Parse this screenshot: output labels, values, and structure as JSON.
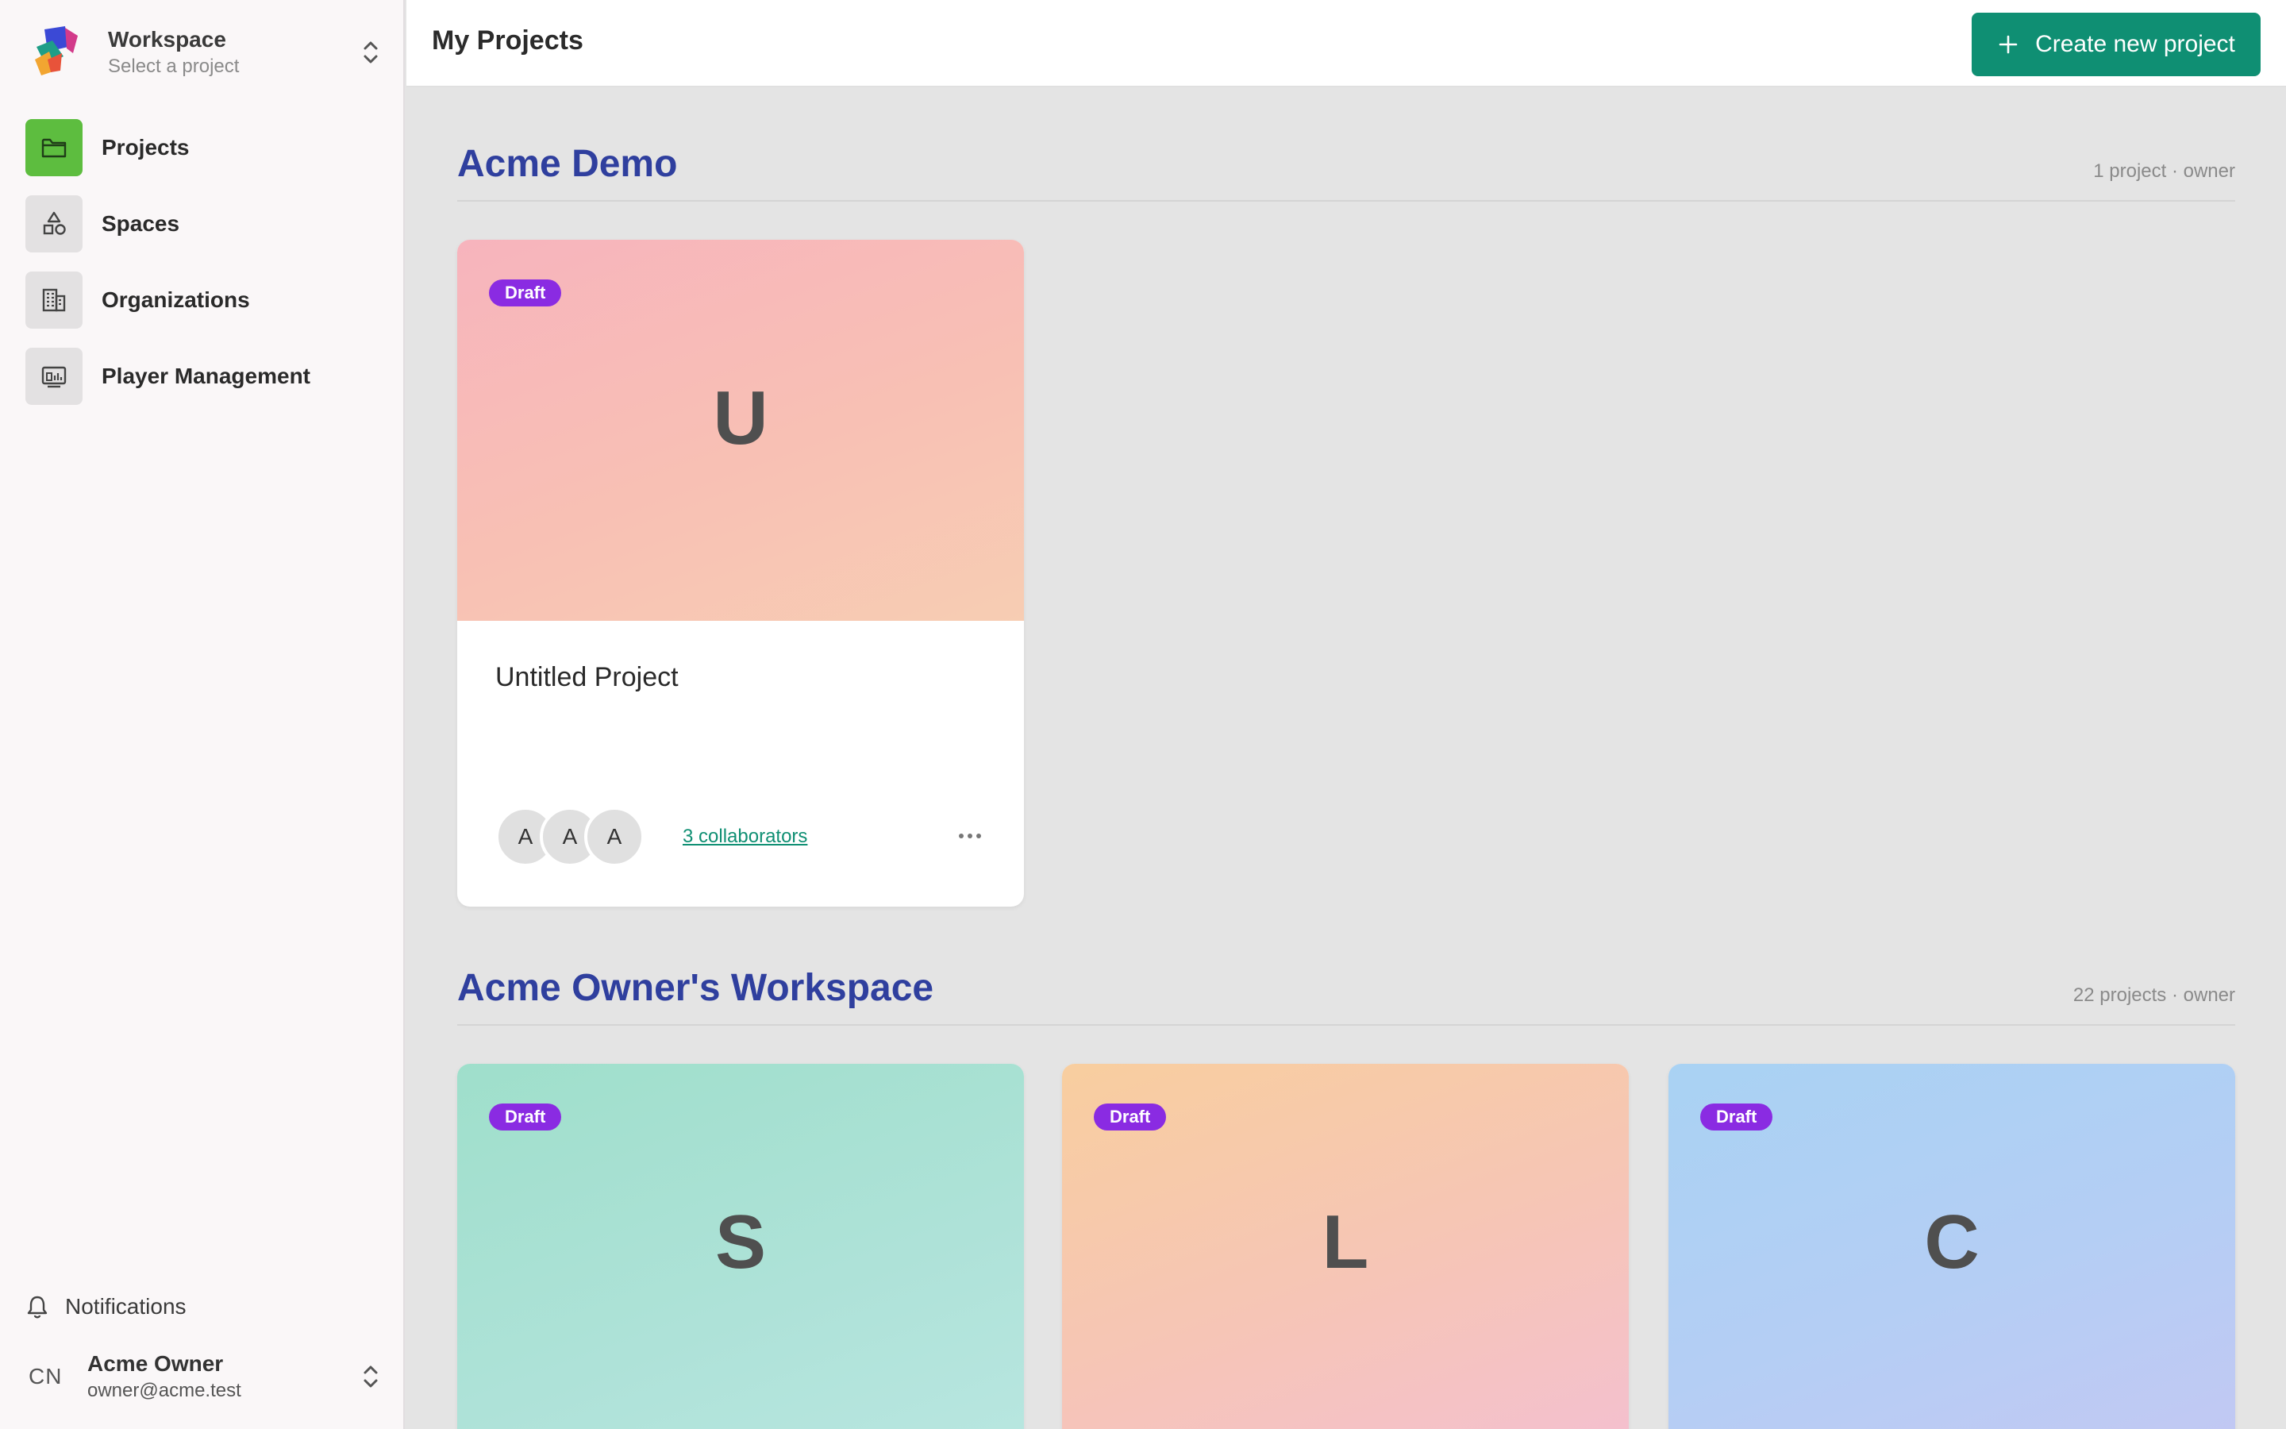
{
  "workspace": {
    "title": "Workspace",
    "subtitle": "Select a project"
  },
  "nav": [
    {
      "label": "Projects",
      "icon": "folder-icon",
      "active": true
    },
    {
      "label": "Spaces",
      "icon": "shapes-icon",
      "active": false
    },
    {
      "label": "Organizations",
      "icon": "building-icon",
      "active": false
    },
    {
      "label": "Player Management",
      "icon": "player-monitor-icon",
      "active": false
    }
  ],
  "notifications": {
    "label": "Notifications",
    "icon": "bell-icon"
  },
  "user": {
    "initials": "CN",
    "name": "Acme Owner",
    "email": "owner@acme.test"
  },
  "header": {
    "title": "My Projects",
    "create_label": "Create new project"
  },
  "colors": {
    "accent": "#0f8f73",
    "nav_active": "#5dbd3f",
    "section_title": "#2f3f9e",
    "draft_badge": "#8a2be2"
  },
  "sections": [
    {
      "title": "Acme Demo",
      "meta": "1 project · owner",
      "projects": [
        {
          "letter": "U",
          "status": "Draft",
          "title": "Untitled Project",
          "collaborator_initials": [
            "A",
            "A",
            "A"
          ],
          "collaborators_label": "3 collaborators"
        }
      ]
    },
    {
      "title": "Acme Owner's Workspace",
      "meta": "22 projects · owner",
      "projects": [
        {
          "letter": "S",
          "status": "Draft"
        },
        {
          "letter": "L",
          "status": "Draft"
        },
        {
          "letter": "C",
          "status": "Draft"
        }
      ]
    }
  ]
}
